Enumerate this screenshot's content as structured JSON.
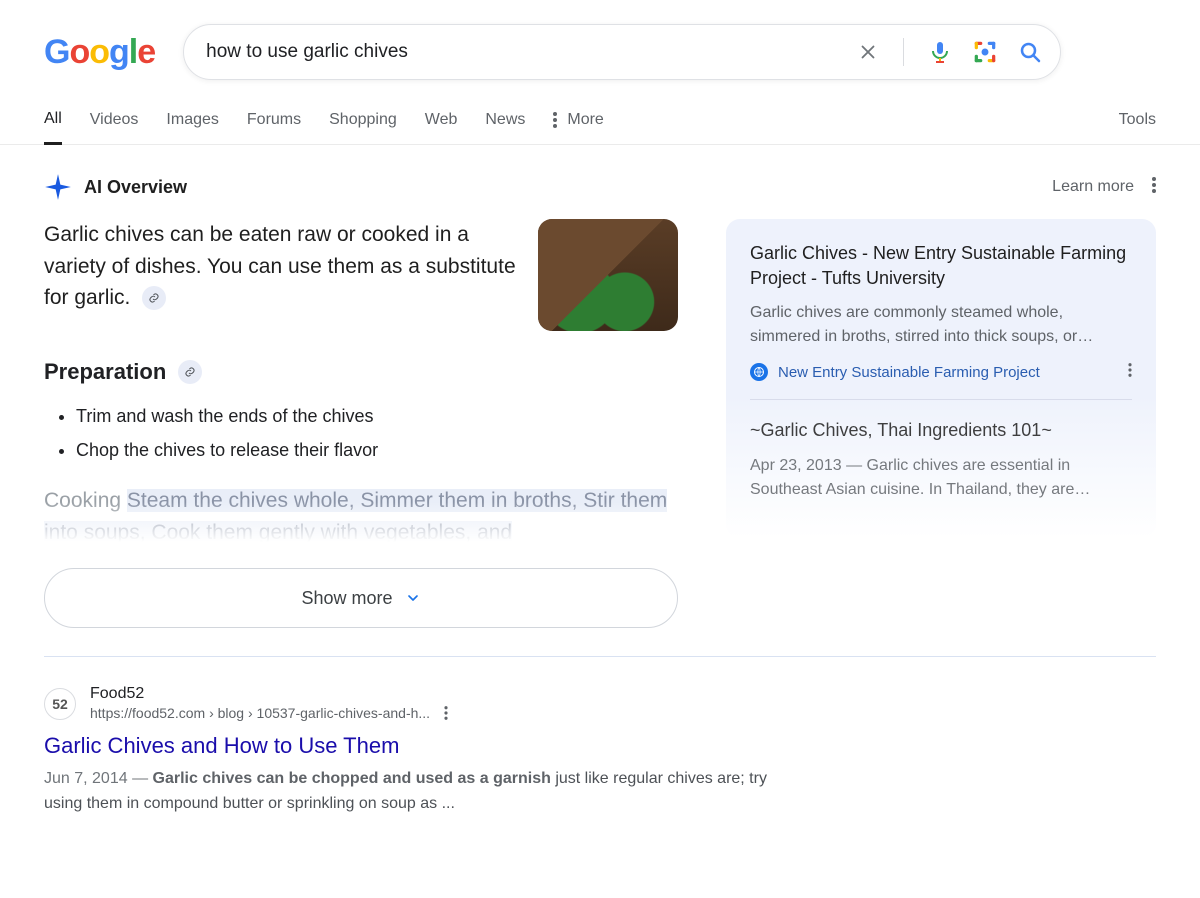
{
  "search": {
    "query": "how to use garlic chives"
  },
  "tabs": {
    "items": [
      "All",
      "Videos",
      "Images",
      "Forums",
      "Shopping",
      "Web",
      "News"
    ],
    "more": "More",
    "tools": "Tools"
  },
  "ai": {
    "label": "AI Overview",
    "learn": "Learn more",
    "intro": "Garlic chives can be eaten raw or cooked in a variety of dishes. You can use them as a substitute for garlic.",
    "prep_heading": "Preparation",
    "steps": [
      "Trim and wash the ends of the chives",
      "Chop the chives to release their flavor"
    ],
    "cook_label": "Cooking",
    "cook_text": "Steam the chives whole, Simmer them in broths, Stir them into soups, Cook them gently with vegetables, and",
    "showmore": "Show more",
    "sources": [
      {
        "title": "Garlic Chives - New Entry Sustainable Farming Project - Tufts University",
        "snippet": "Garlic chives are commonly steamed whole, simmered in broths, stirred into thick soups, or…",
        "site": "New Entry Sustainable Farming Project"
      },
      {
        "title": "~Garlic Chives, Thai Ingredients 101~",
        "snippet": "Apr 23, 2013 — Garlic chives are essential in Southeast Asian cuisine. In Thailand, they are…",
        "site": ""
      }
    ]
  },
  "result": {
    "site": "Food52",
    "favicon_text": "52",
    "url": "https://food52.com › blog › 10537-garlic-chives-and-h...",
    "title": "Garlic Chives and How to Use Them",
    "date": "Jun 7, 2014",
    "bold": "Garlic chives can be chopped and used as a garnish",
    "rest": " just like regular chives are; try using them in compound butter or sprinkling on soup as ..."
  }
}
